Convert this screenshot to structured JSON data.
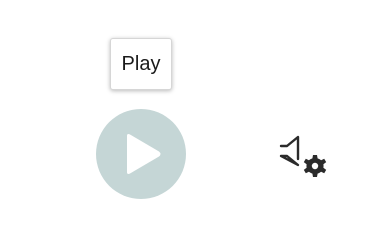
{
  "tooltip": {
    "text": "Play"
  },
  "player": {
    "play_button": {
      "icon": "play-icon",
      "background_color": "#c5d6d6",
      "icon_color": "#ffffff"
    },
    "audio_settings_button": {
      "icon": "speaker-gear-icon",
      "icon_color": "#2b2b2b"
    }
  }
}
